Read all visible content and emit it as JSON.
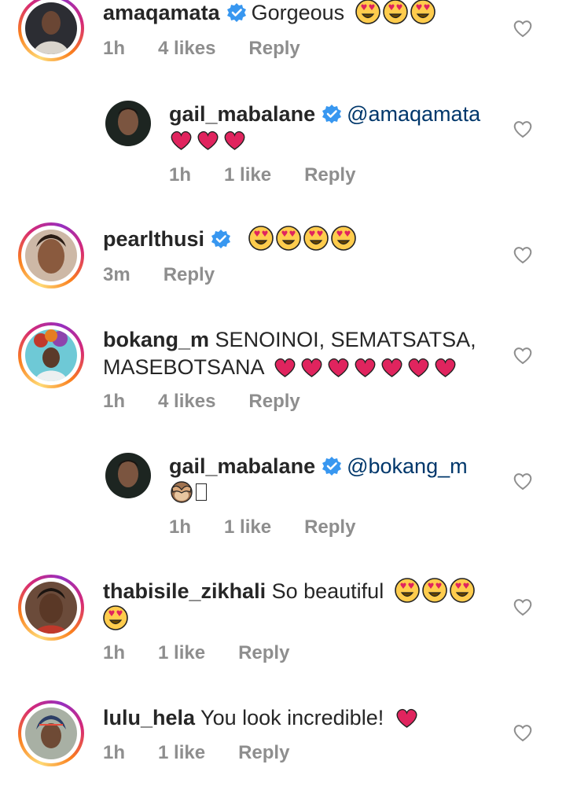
{
  "comments": [
    {
      "username": "amaqamata",
      "verified": true,
      "text": "Gorgeous",
      "emoji": [
        "heart-eyes",
        "heart-eyes",
        "heart-eyes"
      ],
      "time": "1h",
      "likes": "4 likes",
      "reply": "Reply"
    },
    {
      "username": "gail_mabalane",
      "verified": true,
      "mention": "@amaqamata",
      "text": "",
      "emoji": [
        "red-heart",
        "red-heart",
        "red-heart"
      ],
      "time": "1h",
      "likes": "1 like",
      "reply": "Reply",
      "is_reply": true
    },
    {
      "username": "pearlthusi",
      "verified": true,
      "text": "",
      "emoji": [
        "heart-eyes",
        "heart-eyes",
        "heart-eyes",
        "heart-eyes"
      ],
      "time": "3m",
      "reply": "Reply"
    },
    {
      "username": "bokang_m",
      "verified": false,
      "text_line1": "SENOINOI, SEMATSATSA,",
      "text_line2": "MASEBOTSANA",
      "emoji": [
        "red-heart",
        "red-heart",
        "red-heart",
        "red-heart",
        "red-heart",
        "red-heart",
        "red-heart"
      ],
      "time": "1h",
      "likes": "4 likes",
      "reply": "Reply"
    },
    {
      "username": "gail_mabalane",
      "verified": true,
      "mention": "@bokang_m",
      "emoji": [
        "see-no-evil-monkey"
      ],
      "time": "1h",
      "likes": "1 like",
      "reply": "Reply",
      "is_reply": true
    },
    {
      "username": "thabisile_zikhali",
      "verified": false,
      "text": "So beautiful",
      "emoji": [
        "heart-eyes",
        "heart-eyes",
        "heart-eyes",
        "heart-eyes"
      ],
      "time": "1h",
      "likes": "1 like",
      "reply": "Reply"
    },
    {
      "username": "lulu_hela",
      "verified": false,
      "text": "You look incredible!",
      "emoji": [
        "red-heart"
      ],
      "time": "1h",
      "likes": "1 like",
      "reply": "Reply"
    }
  ],
  "colors": {
    "verified_blue": "#3897f0",
    "meta_grey": "#8e8e8e",
    "mention_blue": "#00376b",
    "heart_red": "#e0245e"
  }
}
